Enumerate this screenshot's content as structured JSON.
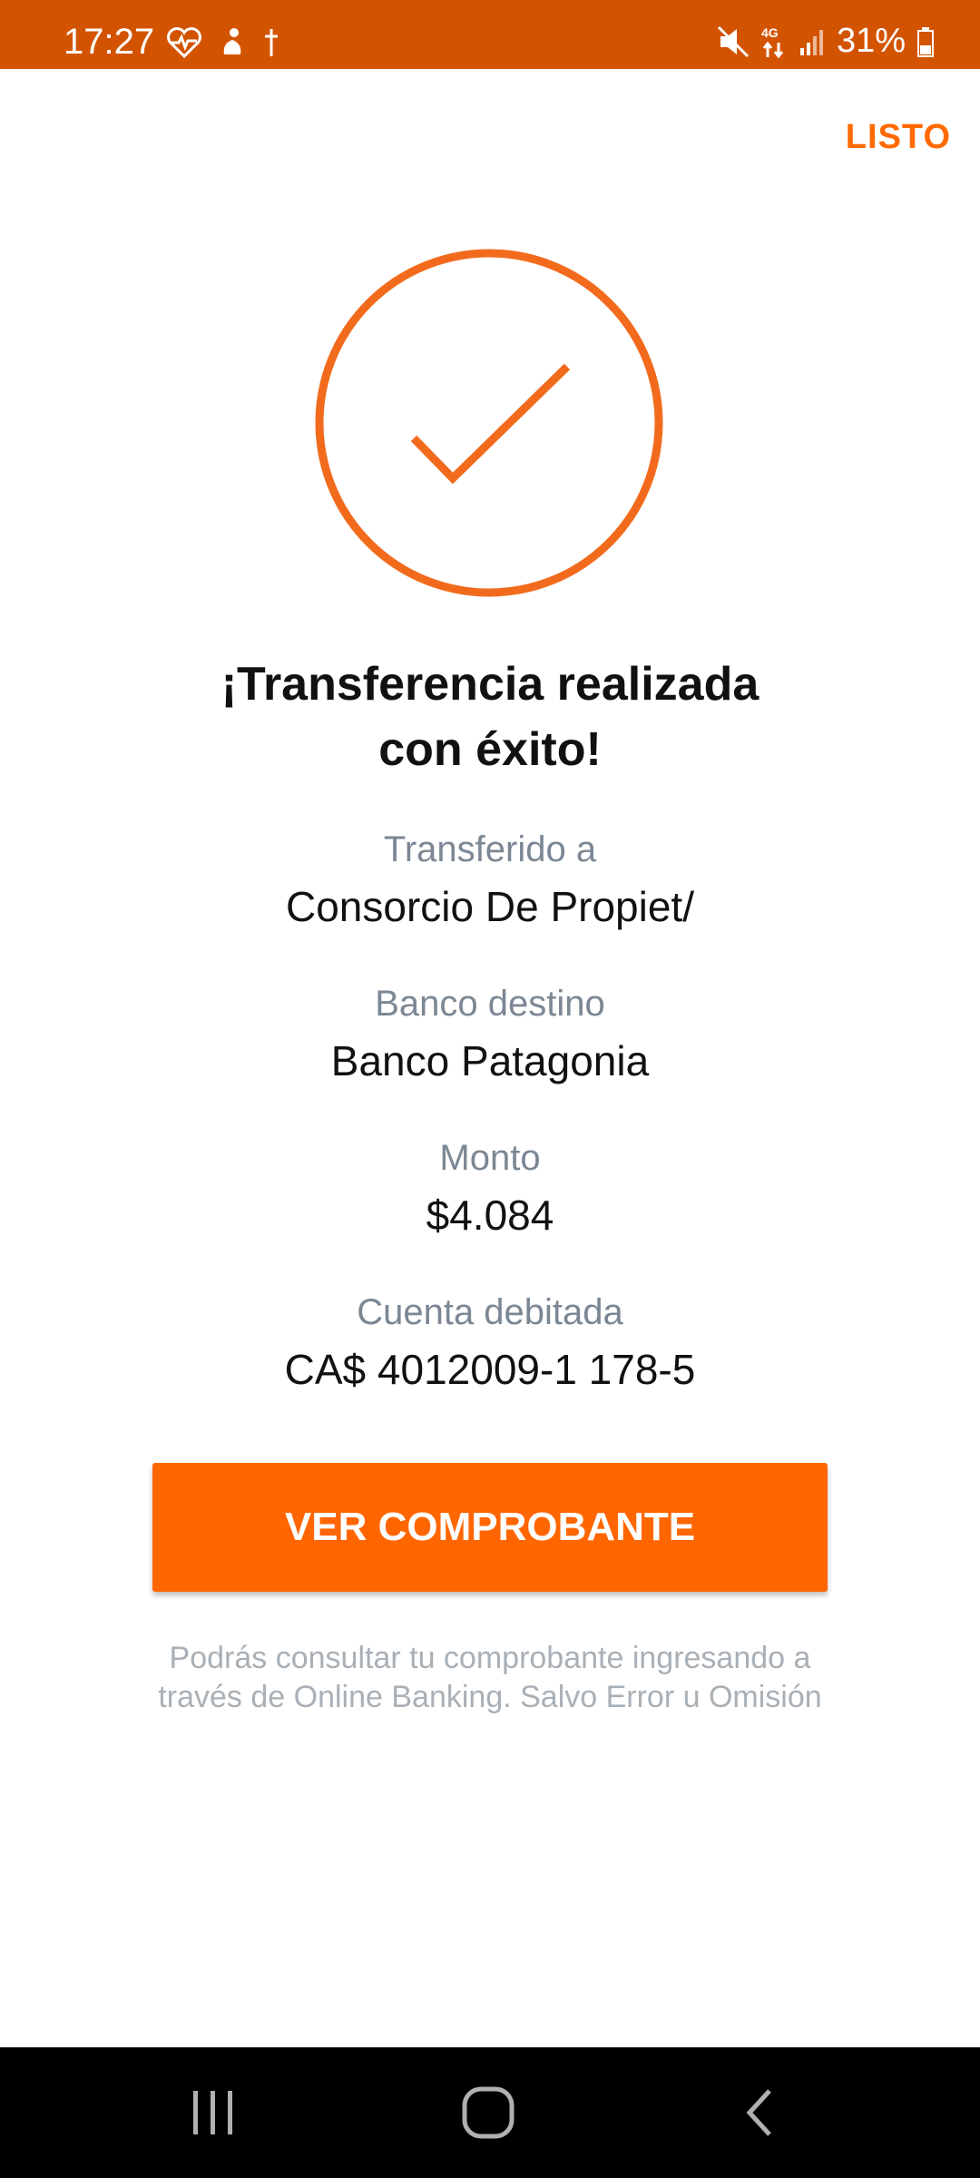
{
  "status_bar": {
    "time": "17:27",
    "battery": "31%",
    "network": "4G",
    "icons": [
      "heart-rate-icon",
      "app-notification-icon",
      "cross-icon",
      "mute-icon",
      "data-arrows-icon",
      "signal-icon",
      "battery-icon"
    ]
  },
  "header": {
    "done_label": "LISTO"
  },
  "success": {
    "icon": "check-circle-icon",
    "title_line1": "¡Transferencia realizada",
    "title_line2": "con éxito!"
  },
  "details": [
    {
      "label": "Transferido a",
      "value": "Consorcio De Propiet/"
    },
    {
      "label": "Banco destino",
      "value": "Banco Patagonia"
    },
    {
      "label": "Monto",
      "value": "$4.084"
    },
    {
      "label": "Cuenta debitada",
      "value": "CA$ 4012009-1 178-5"
    }
  ],
  "actions": {
    "view_receipt_label": "VER COMPROBANTE"
  },
  "footnote": {
    "line1": "Podrás consultar tu comprobante ingresando a",
    "line2": "través de Online Banking. Salvo Error u Omisión"
  },
  "navigation": {
    "buttons": [
      "recent-apps-icon",
      "home-icon",
      "back-icon"
    ]
  },
  "colors": {
    "accent": "#ff6600",
    "status_bar": "#d35400",
    "label_gray": "#7b8794"
  }
}
